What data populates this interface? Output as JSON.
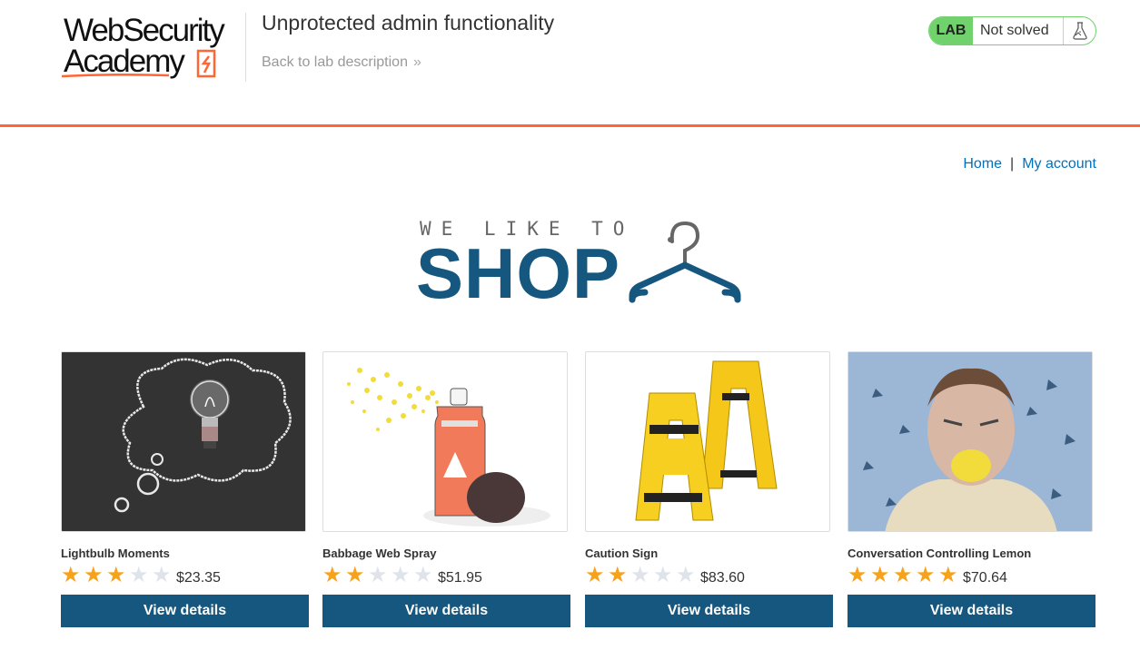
{
  "header": {
    "logo_line1": "WebSecurity",
    "logo_line2": "Academy",
    "lab_title": "Unprotected admin functionality",
    "back_link": "Back to lab description",
    "back_chevron": "»",
    "lab_badge": "LAB",
    "lab_status": "Not solved",
    "flask_icon": "flask-icon"
  },
  "colors": {
    "accent": "#ff6633",
    "brand": "#15577f",
    "link": "#0071bc",
    "status_green": "#70d16d",
    "star_on": "#f7a21b",
    "star_off": "#dfe4ea"
  },
  "nav": {
    "home": "Home",
    "separator": "|",
    "my_account": "My account"
  },
  "banner": {
    "top_text": "WE LIKE TO",
    "main_text": "SHOP"
  },
  "products": [
    {
      "name": "Lightbulb Moments",
      "rating": 3,
      "price": "$23.35",
      "button": "View details",
      "image": "lightbulb-chalkboard"
    },
    {
      "name": "Babbage Web Spray",
      "rating": 2,
      "price": "$51.95",
      "button": "View details",
      "image": "spray-can"
    },
    {
      "name": "Caution Sign",
      "rating": 2,
      "price": "$83.60",
      "button": "View details",
      "image": "caution-sign"
    },
    {
      "name": "Conversation Controlling Lemon",
      "rating": 5,
      "price": "$70.64",
      "button": "View details",
      "image": "man-eating-lemon"
    }
  ]
}
